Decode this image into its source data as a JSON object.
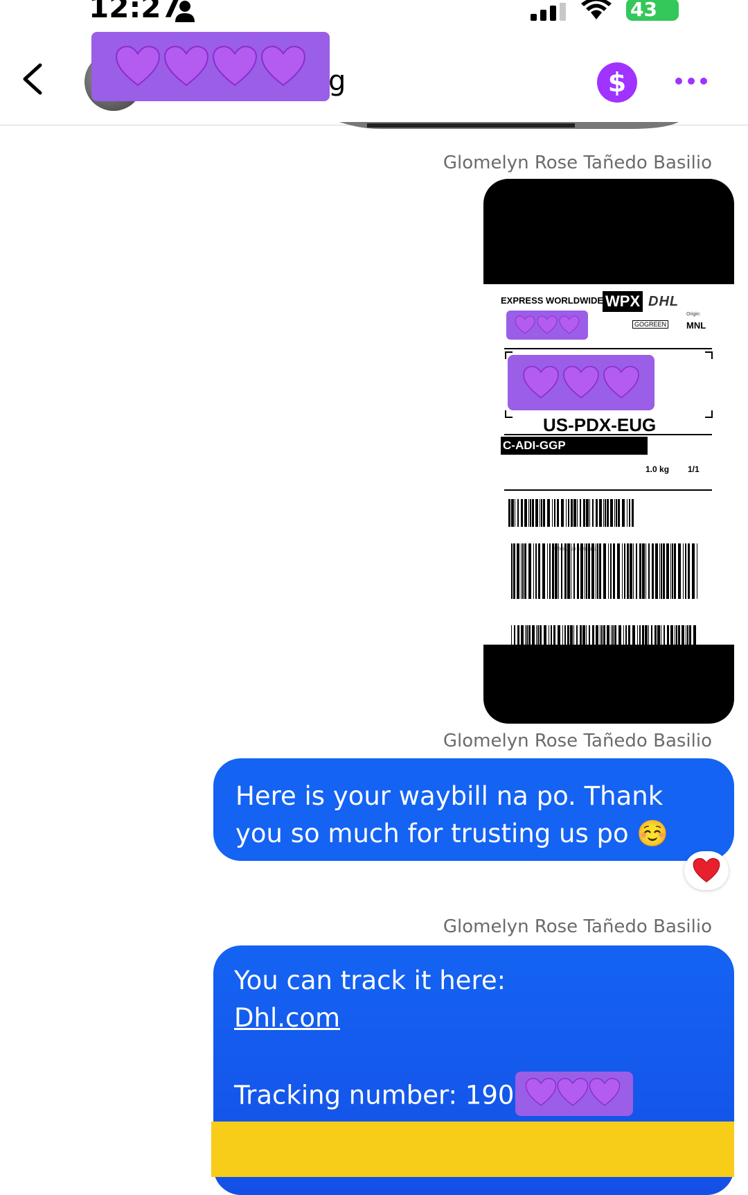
{
  "status_bar": {
    "time": "12:27",
    "battery": "43"
  },
  "header": {
    "name_suffix": "g"
  },
  "messages": [
    {
      "sender": "Glomelyn Rose Tañedo Basilio"
    },
    {
      "sender": "Glomelyn Rose Tañedo Basilio",
      "waybill": {
        "service": "EXPRESS WORLDWIDE",
        "product_code": "WPX",
        "carrier": "DHL",
        "gogreen": "GOGREEN",
        "origin_label": "Origin:",
        "origin": "MNL",
        "route": "US-PDX-EUG",
        "product_line": "C-ADI-GGP",
        "weight": "1.0 kg",
        "pieces": "1/1",
        "waybill_number": "WAYBILL 19 0325 3192"
      }
    },
    {
      "sender": "Glomelyn Rose Tañedo Basilio",
      "text": "Here is your waybill na po. Thank you so much for trusting us po ☺️",
      "reaction": "❤️"
    },
    {
      "sender": "Glomelyn Rose Tañedo Basilio",
      "line1": "You can track it here:",
      "link": "Dhl.com",
      "tracking_prefix": "Tracking number: 190"
    }
  ],
  "colors": {
    "bubble_blue": "#1463f3",
    "redact_purple": "#9b5ee6",
    "pay_purple": "#a033ff",
    "banner_yellow": "#f7cd1a"
  }
}
